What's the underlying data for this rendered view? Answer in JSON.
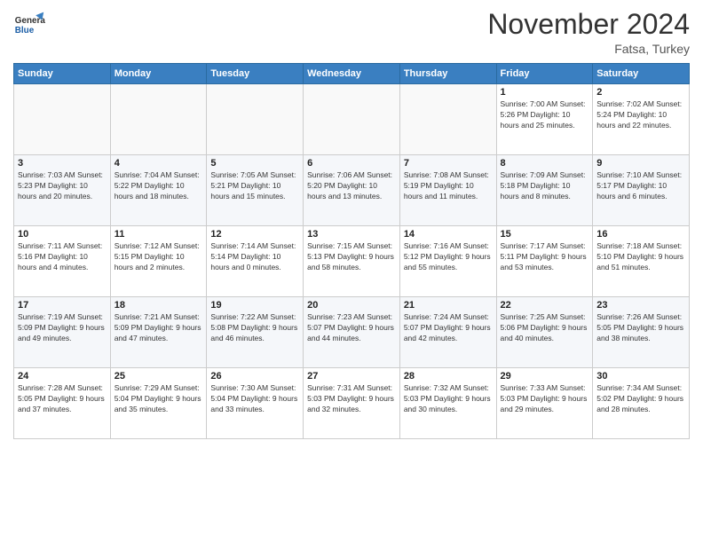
{
  "header": {
    "logo": {
      "general": "General",
      "blue": "Blue"
    },
    "month_title": "November 2024",
    "location": "Fatsa, Turkey"
  },
  "days_of_week": [
    "Sunday",
    "Monday",
    "Tuesday",
    "Wednesday",
    "Thursday",
    "Friday",
    "Saturday"
  ],
  "weeks": [
    [
      {
        "day": "",
        "info": ""
      },
      {
        "day": "",
        "info": ""
      },
      {
        "day": "",
        "info": ""
      },
      {
        "day": "",
        "info": ""
      },
      {
        "day": "",
        "info": ""
      },
      {
        "day": "1",
        "info": "Sunrise: 7:00 AM\nSunset: 5:26 PM\nDaylight: 10 hours and 25 minutes."
      },
      {
        "day": "2",
        "info": "Sunrise: 7:02 AM\nSunset: 5:24 PM\nDaylight: 10 hours and 22 minutes."
      }
    ],
    [
      {
        "day": "3",
        "info": "Sunrise: 7:03 AM\nSunset: 5:23 PM\nDaylight: 10 hours and 20 minutes."
      },
      {
        "day": "4",
        "info": "Sunrise: 7:04 AM\nSunset: 5:22 PM\nDaylight: 10 hours and 18 minutes."
      },
      {
        "day": "5",
        "info": "Sunrise: 7:05 AM\nSunset: 5:21 PM\nDaylight: 10 hours and 15 minutes."
      },
      {
        "day": "6",
        "info": "Sunrise: 7:06 AM\nSunset: 5:20 PM\nDaylight: 10 hours and 13 minutes."
      },
      {
        "day": "7",
        "info": "Sunrise: 7:08 AM\nSunset: 5:19 PM\nDaylight: 10 hours and 11 minutes."
      },
      {
        "day": "8",
        "info": "Sunrise: 7:09 AM\nSunset: 5:18 PM\nDaylight: 10 hours and 8 minutes."
      },
      {
        "day": "9",
        "info": "Sunrise: 7:10 AM\nSunset: 5:17 PM\nDaylight: 10 hours and 6 minutes."
      }
    ],
    [
      {
        "day": "10",
        "info": "Sunrise: 7:11 AM\nSunset: 5:16 PM\nDaylight: 10 hours and 4 minutes."
      },
      {
        "day": "11",
        "info": "Sunrise: 7:12 AM\nSunset: 5:15 PM\nDaylight: 10 hours and 2 minutes."
      },
      {
        "day": "12",
        "info": "Sunrise: 7:14 AM\nSunset: 5:14 PM\nDaylight: 10 hours and 0 minutes."
      },
      {
        "day": "13",
        "info": "Sunrise: 7:15 AM\nSunset: 5:13 PM\nDaylight: 9 hours and 58 minutes."
      },
      {
        "day": "14",
        "info": "Sunrise: 7:16 AM\nSunset: 5:12 PM\nDaylight: 9 hours and 55 minutes."
      },
      {
        "day": "15",
        "info": "Sunrise: 7:17 AM\nSunset: 5:11 PM\nDaylight: 9 hours and 53 minutes."
      },
      {
        "day": "16",
        "info": "Sunrise: 7:18 AM\nSunset: 5:10 PM\nDaylight: 9 hours and 51 minutes."
      }
    ],
    [
      {
        "day": "17",
        "info": "Sunrise: 7:19 AM\nSunset: 5:09 PM\nDaylight: 9 hours and 49 minutes."
      },
      {
        "day": "18",
        "info": "Sunrise: 7:21 AM\nSunset: 5:09 PM\nDaylight: 9 hours and 47 minutes."
      },
      {
        "day": "19",
        "info": "Sunrise: 7:22 AM\nSunset: 5:08 PM\nDaylight: 9 hours and 46 minutes."
      },
      {
        "day": "20",
        "info": "Sunrise: 7:23 AM\nSunset: 5:07 PM\nDaylight: 9 hours and 44 minutes."
      },
      {
        "day": "21",
        "info": "Sunrise: 7:24 AM\nSunset: 5:07 PM\nDaylight: 9 hours and 42 minutes."
      },
      {
        "day": "22",
        "info": "Sunrise: 7:25 AM\nSunset: 5:06 PM\nDaylight: 9 hours and 40 minutes."
      },
      {
        "day": "23",
        "info": "Sunrise: 7:26 AM\nSunset: 5:05 PM\nDaylight: 9 hours and 38 minutes."
      }
    ],
    [
      {
        "day": "24",
        "info": "Sunrise: 7:28 AM\nSunset: 5:05 PM\nDaylight: 9 hours and 37 minutes."
      },
      {
        "day": "25",
        "info": "Sunrise: 7:29 AM\nSunset: 5:04 PM\nDaylight: 9 hours and 35 minutes."
      },
      {
        "day": "26",
        "info": "Sunrise: 7:30 AM\nSunset: 5:04 PM\nDaylight: 9 hours and 33 minutes."
      },
      {
        "day": "27",
        "info": "Sunrise: 7:31 AM\nSunset: 5:03 PM\nDaylight: 9 hours and 32 minutes."
      },
      {
        "day": "28",
        "info": "Sunrise: 7:32 AM\nSunset: 5:03 PM\nDaylight: 9 hours and 30 minutes."
      },
      {
        "day": "29",
        "info": "Sunrise: 7:33 AM\nSunset: 5:03 PM\nDaylight: 9 hours and 29 minutes."
      },
      {
        "day": "30",
        "info": "Sunrise: 7:34 AM\nSunset: 5:02 PM\nDaylight: 9 hours and 28 minutes."
      }
    ]
  ]
}
